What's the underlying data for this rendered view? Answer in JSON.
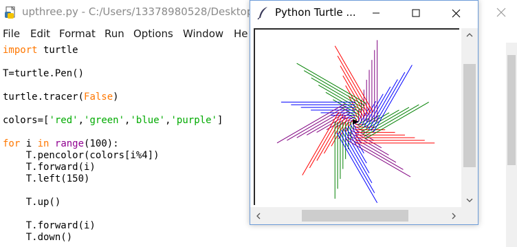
{
  "idle": {
    "title": "upthree.py - C:/Users/13378980528/Desktop/",
    "menu": [
      "File",
      "Edit",
      "Format",
      "Run",
      "Options",
      "Window",
      "He"
    ],
    "icons": {
      "file": "python-file-icon",
      "close": "close-icon"
    },
    "code": [
      [
        {
          "t": "import",
          "c": "kw"
        },
        {
          "t": " turtle",
          "c": ""
        }
      ],
      [],
      [
        {
          "t": "T=turtle.Pen()",
          "c": ""
        }
      ],
      [],
      [
        {
          "t": "turtle.tracer(",
          "c": ""
        },
        {
          "t": "False",
          "c": "kw2"
        },
        {
          "t": ")",
          "c": ""
        }
      ],
      [],
      [
        {
          "t": "colors=[",
          "c": ""
        },
        {
          "t": "'red'",
          "c": "str"
        },
        {
          "t": ",",
          "c": ""
        },
        {
          "t": "'green'",
          "c": "str"
        },
        {
          "t": ",",
          "c": ""
        },
        {
          "t": "'blue'",
          "c": "str"
        },
        {
          "t": ",",
          "c": ""
        },
        {
          "t": "'purple'",
          "c": "str"
        },
        {
          "t": "]",
          "c": ""
        }
      ],
      [],
      [
        {
          "t": "for",
          "c": "kw"
        },
        {
          "t": " i ",
          "c": ""
        },
        {
          "t": "in",
          "c": "kw"
        },
        {
          "t": " ",
          "c": ""
        },
        {
          "t": "range",
          "c": "bi"
        },
        {
          "t": "(100):",
          "c": ""
        }
      ],
      [
        {
          "t": "    T.pencolor(colors[i%4])",
          "c": ""
        }
      ],
      [
        {
          "t": "    T.forward(i)",
          "c": ""
        }
      ],
      [
        {
          "t": "    T.left(150)",
          "c": ""
        }
      ],
      [],
      [
        {
          "t": "    T.up()",
          "c": ""
        }
      ],
      [],
      [
        {
          "t": "    T.forward(i)",
          "c": ""
        }
      ],
      [
        {
          "t": "    T.down()",
          "c": ""
        }
      ]
    ]
  },
  "turtle_window": {
    "title": "Python Turtle ...",
    "icons": {
      "app": "feather-icon",
      "minimize": "minimize-icon",
      "maximize": "maximize-icon",
      "close": "close-icon",
      "scroll_up": "chevron-up-icon",
      "scroll_down": "chevron-down-icon",
      "scroll_left": "chevron-left-icon",
      "scroll_right": "chevron-right-icon"
    },
    "drawing": {
      "pen_colors": [
        "#ff0000",
        "#008000",
        "#0000ff",
        "#800080"
      ],
      "steps": 100,
      "turn_degrees": 150
    }
  }
}
